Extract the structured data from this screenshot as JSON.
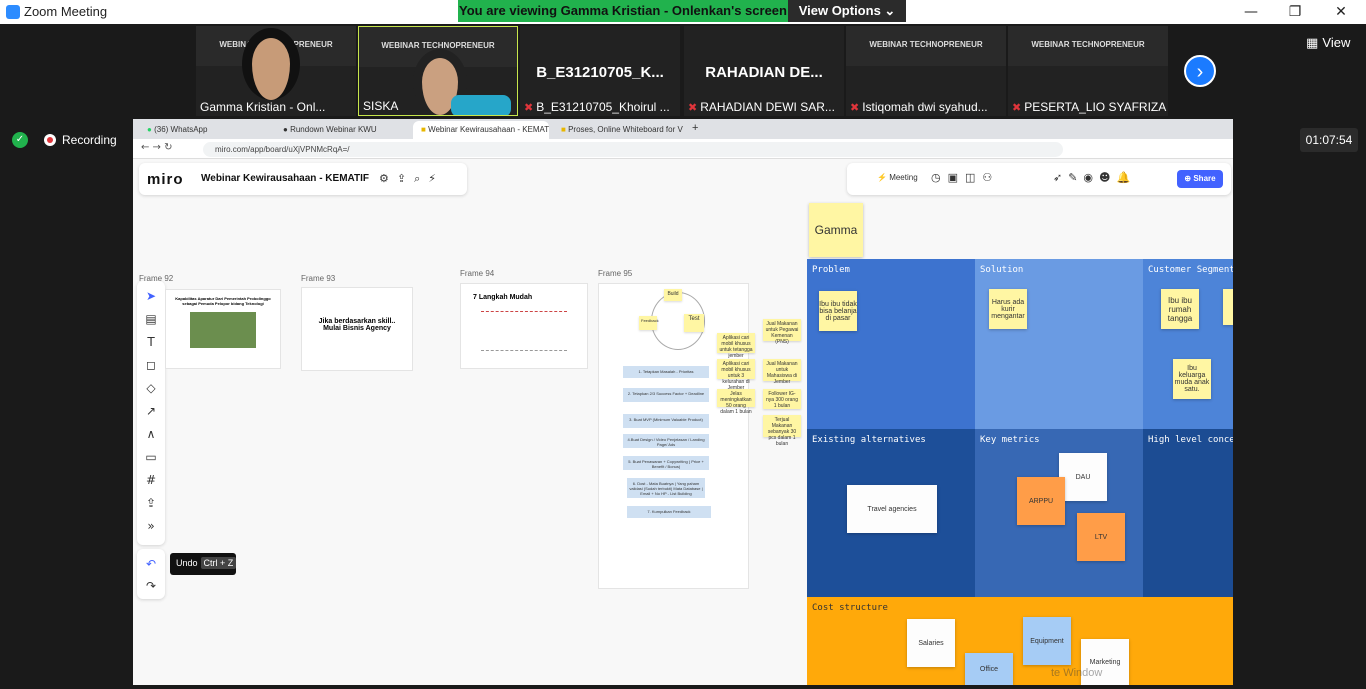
{
  "window": {
    "title": "Zoom Meeting",
    "minimize": "—",
    "maximize": "❐",
    "close": "✕"
  },
  "banner": {
    "text": "You are viewing Gamma Kristian - Onlenkan's screen",
    "view_options": "View Options ⌄"
  },
  "participants": [
    {
      "name": "Gamma Kristian - Onl...",
      "video": true
    },
    {
      "name": "SISKA",
      "video": true,
      "active": true
    },
    {
      "name": "B_E31210705_Khoirul ...",
      "display": "B_E31210705_K...",
      "muted": true
    },
    {
      "name": "RAHADIAN DEWI SAR...",
      "display": "RAHADIAN  DE...",
      "muted": true
    },
    {
      "name": "Istiqomah dwi syahud...",
      "muted": true,
      "video": true
    },
    {
      "name": "PESERTA_LIO SYAFRIZA",
      "muted": true,
      "video": true
    }
  ],
  "tile_banner": "WEBINAR TECHNOPRENEUR",
  "view_button": "View",
  "recording": "Recording",
  "timer": "01:07:54",
  "browser": {
    "tabs": [
      "(36) WhatsApp",
      "Rundown Webinar KWU",
      "Webinar Kewirausahaan - KEMAT",
      "Proses, Online Whiteboard for V"
    ],
    "url": "miro.com/app/board/uXjVPNMcRqA=/"
  },
  "miro": {
    "logo": "miro",
    "board_name": "Webinar Kewirausahaan - KEMATIF",
    "meeting": "Meeting",
    "share": "Share",
    "undo_tooltip": "Undo",
    "undo_shortcut": "Ctrl + Z",
    "frames": [
      {
        "label": "Frame 92",
        "text": "Kapabilitas Aparatur Dari Pemerintah Probolinggo sebagai Pemuda Pelopor bidang Teknologi"
      },
      {
        "label": "Frame 93",
        "text": "Jika berdasarkan skill.. Mulai Bisnis Agency"
      },
      {
        "label": "Frame 94",
        "text": "7 Langkah Mudah"
      },
      {
        "label": "Frame 95"
      }
    ],
    "cycle": {
      "build": "Build",
      "test": "Test",
      "feedback": "Feedback"
    },
    "steps": [
      "1. Tetapkan Masalah - Prioritas",
      "2. Tetapkan 2/3 Success Factor + Deadline",
      "3. Buat MVP (Minimum Valuable Product)",
      "4.Buat Design / Video Penjelasan / Landing Page/ Ads",
      "5. Buat Penawaran + Copywriting ( Price + Benefit / Bonus)",
      "6. Dost - Mata Buatnya | Yang paham validasi (Sudah terbukti) Mata Database | Email + No HP - List Building",
      "7. Kumpulkan Feedback"
    ],
    "side_stickies": [
      "Jual Makanan untuk Pegawai Kemenan (PNS)",
      "Aplikasi cari mobil khusus untuk tetangga jember",
      "Jual Makanan untuk Mahasiswa di Jember",
      "Aplikasi cari mobil khusus untuk 3 kelurahan di Jember",
      "Follower IG-nya 300 orang 1 bulan",
      "Jelas meningkatkan 50 orang dalam 1 bulan",
      "Terjual Makanan sebanyak 30 pcs dalam 1 bulan"
    ],
    "gamma_sticky": "Gamma",
    "canvas": {
      "problem": {
        "title": "Problem",
        "notes": [
          "Ibu ibu tidak bisa belanja di pasar"
        ]
      },
      "solution": {
        "title": "Solution",
        "notes": [
          "Harus ada kurir mengantar"
        ]
      },
      "segments": {
        "title": "Customer Segment",
        "notes": [
          "Ibu ibu rumah tangga",
          "Ibu keluarga muda anak satu."
        ]
      },
      "alternatives": {
        "title": "Existing alternatives",
        "notes": [
          "Travel agencies"
        ]
      },
      "metrics": {
        "title": "Key metrics",
        "notes": [
          "DAU",
          "ARPPU",
          "LTV"
        ]
      },
      "concept": {
        "title": "High level conce"
      },
      "cost": {
        "title": "Cost structure",
        "notes": [
          "Salaries",
          "Equipment",
          "Office",
          "Marketing"
        ]
      }
    },
    "watermark": "te Window"
  }
}
